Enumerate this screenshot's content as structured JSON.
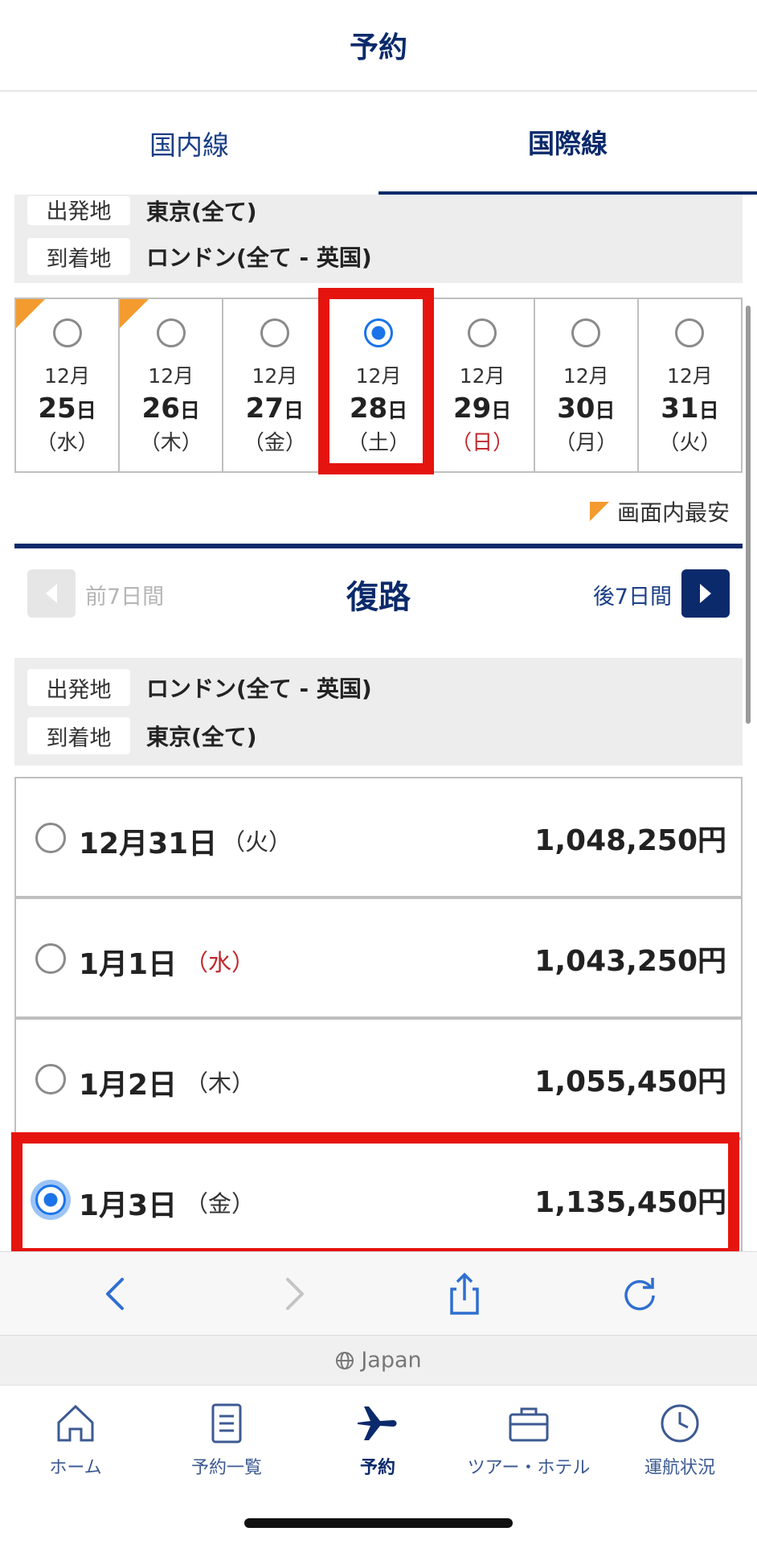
{
  "header": {
    "title": "予約"
  },
  "tabs": [
    {
      "label": "国内線",
      "active": false
    },
    {
      "label": "国際線",
      "active": true
    }
  ],
  "outbound": {
    "departure_label": "出発地",
    "departure_value": "東京(全て)",
    "arrival_label": "到着地",
    "arrival_value": "ロンドン(全て - 英国)",
    "dates": [
      {
        "month": "12月",
        "day": "25",
        "day_suffix": "日",
        "dow": "（水）",
        "selected": false,
        "cheapest": true,
        "sunday": false
      },
      {
        "month": "12月",
        "day": "26",
        "day_suffix": "日",
        "dow": "（木）",
        "selected": false,
        "cheapest": true,
        "sunday": false
      },
      {
        "month": "12月",
        "day": "27",
        "day_suffix": "日",
        "dow": "（金）",
        "selected": false,
        "cheapest": false,
        "sunday": false
      },
      {
        "month": "12月",
        "day": "28",
        "day_suffix": "日",
        "dow": "（土）",
        "selected": true,
        "cheapest": false,
        "sunday": false
      },
      {
        "month": "12月",
        "day": "29",
        "day_suffix": "日",
        "dow": "（日）",
        "selected": false,
        "cheapest": false,
        "sunday": true
      },
      {
        "month": "12月",
        "day": "30",
        "day_suffix": "日",
        "dow": "（月）",
        "selected": false,
        "cheapest": false,
        "sunday": false
      },
      {
        "month": "12月",
        "day": "31",
        "day_suffix": "日",
        "dow": "（火）",
        "selected": false,
        "cheapest": false,
        "sunday": false
      }
    ],
    "legend": "画面内最安"
  },
  "return_section": {
    "prev_label": "前7日間",
    "title": "復路",
    "next_label": "後7日間",
    "departure_label": "出発地",
    "departure_value": "ロンドン(全て - 英国)",
    "arrival_label": "到着地",
    "arrival_value": "東京(全て)",
    "options": [
      {
        "date": "12月31日",
        "dow": "（火）",
        "price": "1,048,250円",
        "selected": false,
        "holiday": false
      },
      {
        "date": "1月1日",
        "dow": "（水）",
        "price": "1,043,250円",
        "selected": false,
        "holiday": true
      },
      {
        "date": "1月2日",
        "dow": "（木）",
        "price": "1,055,450円",
        "selected": false,
        "holiday": false
      },
      {
        "date": "1月3日",
        "dow": "（金）",
        "price": "1,135,450円",
        "selected": true,
        "holiday": false
      }
    ]
  },
  "browser": {
    "region": "Japan"
  },
  "bottom_nav": [
    {
      "label": "ホーム",
      "icon": "home-icon",
      "active": false
    },
    {
      "label": "予約一覧",
      "icon": "document-list-icon",
      "active": false
    },
    {
      "label": "予約",
      "icon": "airplane-icon",
      "active": true
    },
    {
      "label": "ツアー・ホテル",
      "icon": "suitcase-icon",
      "active": false
    },
    {
      "label": "運航状況",
      "icon": "clock-icon",
      "active": false
    }
  ],
  "colors": {
    "brand_navy": "#0b2a6b",
    "highlight_red": "#e5140f",
    "cheapest_orange": "#f39b2e",
    "radio_blue": "#1a73e8",
    "sunday_red": "#c0282d"
  }
}
